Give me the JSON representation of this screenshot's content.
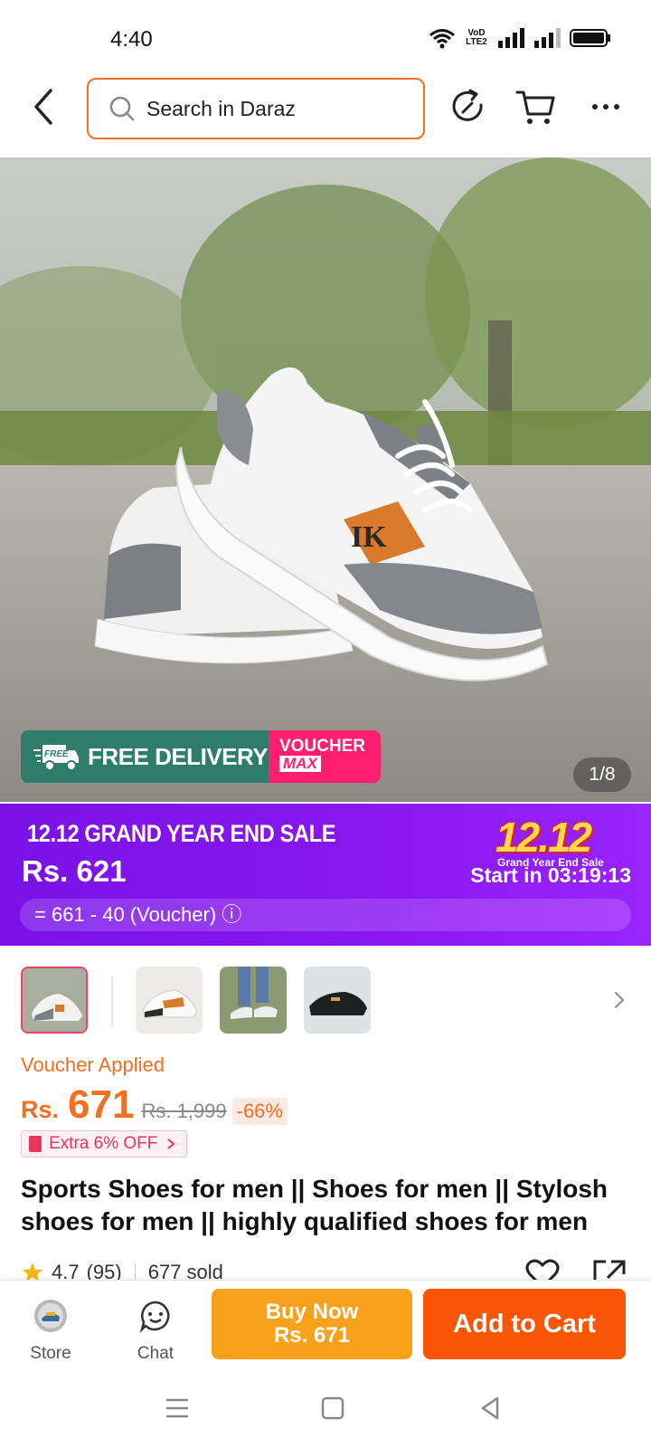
{
  "status_bar": {
    "time": "4:40",
    "volte_top": "VoD",
    "volte_bottom": "LTE2"
  },
  "search": {
    "placeholder": "Search in Daraz"
  },
  "hero": {
    "badge_free": "FREE DELIVERY",
    "badge_free_mini": "FREE",
    "badge_voucher": "VOUCHER",
    "badge_max": "MAX",
    "counter": "1/8"
  },
  "sale": {
    "title": "12.12 GRAND YEAR END SALE",
    "price": "Rs. 621",
    "calc": "= 661 - 40 (Voucher) ⓘ",
    "logo_number": "12.12",
    "logo_sub": "Grand Year End Sale",
    "timer": "Start in 03:19:13",
    "colors": {
      "bg_start": "#7a12e8",
      "bg_end": "#9a24ff"
    }
  },
  "thumbnails": {
    "count_visible": 4,
    "selected_index": 0
  },
  "price": {
    "voucher_applied": "Voucher Applied",
    "currency": "Rs.",
    "amount": "671",
    "original": "Rs. 1,999",
    "discount": "-66%",
    "extra_off": "Extra 6% OFF"
  },
  "product": {
    "title": "Sports Shoes for men || Shoes for men || Stylosh shoes for men || highly qualified shoes for men",
    "rating": "4.7",
    "reviews": "(95)",
    "sold": "677 sold"
  },
  "bottom_bar": {
    "store_label": "Store",
    "chat_label": "Chat",
    "buy_now_line1": "Buy Now",
    "buy_now_line2": "Rs. 671",
    "add_to_cart": "Add to Cart"
  },
  "colors": {
    "accent": "#f36f21",
    "buy_now": "#f8a21b",
    "add_to_cart": "#f85606",
    "sale_purple": "#8a17f0"
  },
  "icons": [
    "back-arrow-icon",
    "search-icon",
    "share-refresh-icon",
    "cart-icon",
    "more-dots-icon",
    "heart-icon",
    "share-icon",
    "store-icon",
    "chat-icon"
  ]
}
